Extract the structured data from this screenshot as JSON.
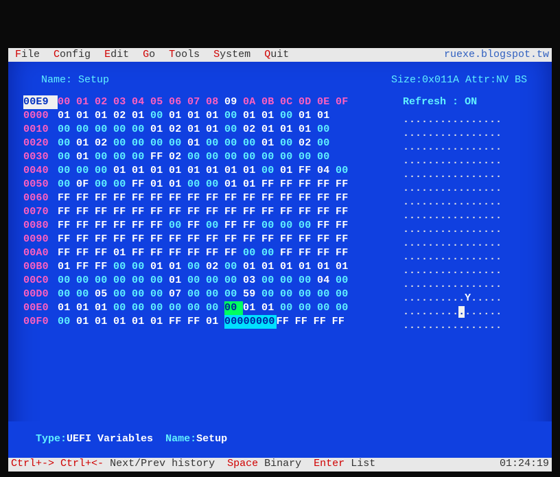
{
  "menu": [
    {
      "hot": "F",
      "rest": "ile"
    },
    {
      "hot": "C",
      "rest": "onfig"
    },
    {
      "hot": "E",
      "rest": "dit"
    },
    {
      "hot": "G",
      "rest": "o"
    },
    {
      "hot": "T",
      "rest": "ools"
    },
    {
      "hot": "S",
      "rest": "ystem"
    },
    {
      "hot": "Q",
      "rest": "uit"
    }
  ],
  "url": "ruexe.blogspot.tw",
  "name_label": "Name:",
  "name_value": "Setup",
  "size_attr": "Size:0x011A Attr:NV BS",
  "refresh_label": "Refresh",
  "refresh_sep": ":",
  "refresh_value": "ON",
  "col_header_offset": "00E9",
  "col_headers": [
    "00",
    "01",
    "02",
    "03",
    "04",
    "05",
    "06",
    "07",
    "08",
    "09",
    "0A",
    "0B",
    "0C",
    "0D",
    "0E",
    "0F"
  ],
  "rows": [
    {
      "off": "0000",
      "b": [
        "01",
        "01",
        "01",
        "02",
        "01",
        "00",
        "01",
        "01",
        "01",
        "00",
        "01",
        "01",
        "00",
        "01",
        "01"
      ]
    },
    {
      "off": "0010",
      "b": [
        "00",
        "00",
        "00",
        "00",
        "00",
        "01",
        "02",
        "01",
        "01",
        "00",
        "02",
        "01",
        "01",
        "01",
        "00"
      ]
    },
    {
      "off": "0020",
      "b": [
        "00",
        "01",
        "02",
        "00",
        "00",
        "00",
        "00",
        "01",
        "00",
        "00",
        "00",
        "01",
        "00",
        "02",
        "00"
      ]
    },
    {
      "off": "0030",
      "b": [
        "00",
        "01",
        "00",
        "00",
        "00",
        "FF",
        "02",
        "00",
        "00",
        "00",
        "00",
        "00",
        "00",
        "00",
        "00"
      ]
    },
    {
      "off": "0040",
      "b": [
        "00",
        "00",
        "00",
        "01",
        "01",
        "01",
        "01",
        "01",
        "01",
        "01",
        "01",
        "00",
        "01",
        "FF",
        "04",
        "00"
      ]
    },
    {
      "off": "0050",
      "b": [
        "00",
        "0F",
        "00",
        "00",
        "FF",
        "01",
        "01",
        "00",
        "00",
        "01",
        "01",
        "FF",
        "FF",
        "FF",
        "FF",
        "FF"
      ]
    },
    {
      "off": "0060",
      "b": [
        "FF",
        "FF",
        "FF",
        "FF",
        "FF",
        "FF",
        "FF",
        "FF",
        "FF",
        "FF",
        "FF",
        "FF",
        "FF",
        "FF",
        "FF",
        "FF"
      ]
    },
    {
      "off": "0070",
      "b": [
        "FF",
        "FF",
        "FF",
        "FF",
        "FF",
        "FF",
        "FF",
        "FF",
        "FF",
        "FF",
        "FF",
        "FF",
        "FF",
        "FF",
        "FF",
        "FF"
      ]
    },
    {
      "off": "0080",
      "b": [
        "FF",
        "FF",
        "FF",
        "FF",
        "FF",
        "FF",
        "00",
        "FF",
        "00",
        "FF",
        "FF",
        "00",
        "00",
        "00",
        "FF",
        "FF"
      ]
    },
    {
      "off": "0090",
      "b": [
        "FF",
        "FF",
        "FF",
        "FF",
        "FF",
        "FF",
        "FF",
        "FF",
        "FF",
        "FF",
        "FF",
        "FF",
        "FF",
        "FF",
        "FF",
        "FF"
      ]
    },
    {
      "off": "00A0",
      "b": [
        "FF",
        "FF",
        "FF",
        "01",
        "FF",
        "FF",
        "FF",
        "FF",
        "FF",
        "FF",
        "00",
        "00",
        "FF",
        "FF",
        "FF",
        "FF"
      ]
    },
    {
      "off": "00B0",
      "b": [
        "01",
        "FF",
        "FF",
        "00",
        "00",
        "01",
        "01",
        "00",
        "02",
        "00",
        "01",
        "01",
        "01",
        "01",
        "01",
        "01"
      ]
    },
    {
      "off": "00C0",
      "b": [
        "00",
        "00",
        "00",
        "00",
        "00",
        "00",
        "01",
        "00",
        "00",
        "00",
        "03",
        "00",
        "00",
        "00",
        "04",
        "00"
      ]
    },
    {
      "off": "00D0",
      "b": [
        "00",
        "00",
        "05",
        "00",
        "00",
        "00",
        "07",
        "00",
        "00",
        "00",
        "59",
        "00",
        "00",
        "00",
        "00",
        "00"
      ]
    },
    {
      "off": "00E0",
      "b": [
        "01",
        "01",
        "01",
        "00",
        "00",
        "00",
        "00",
        "00",
        "00",
        "00",
        "01",
        "01",
        "00",
        "00",
        "00",
        "00"
      ],
      "cursor": 9
    },
    {
      "off": "00F0",
      "b": [
        "00",
        "01",
        "01",
        "01",
        "01",
        "01",
        "FF",
        "FF",
        "01",
        "00000000",
        "FF",
        "FF",
        "FF",
        "FF"
      ],
      "sel": 9
    }
  ],
  "ascii_y_row": "..........Y.....",
  "status_type_label": "Type:",
  "status_type_value": "UEFI Variables",
  "status_name_label": "Name:",
  "status_name_value": "Setup",
  "footer": {
    "k1": "Ctrl+->",
    "k2": "Ctrl+<-",
    "t1": "Next/Prev history",
    "k3": "Space",
    "t3": "Binary",
    "k4": "Enter",
    "t4": "List",
    "time": "01:24:19"
  }
}
